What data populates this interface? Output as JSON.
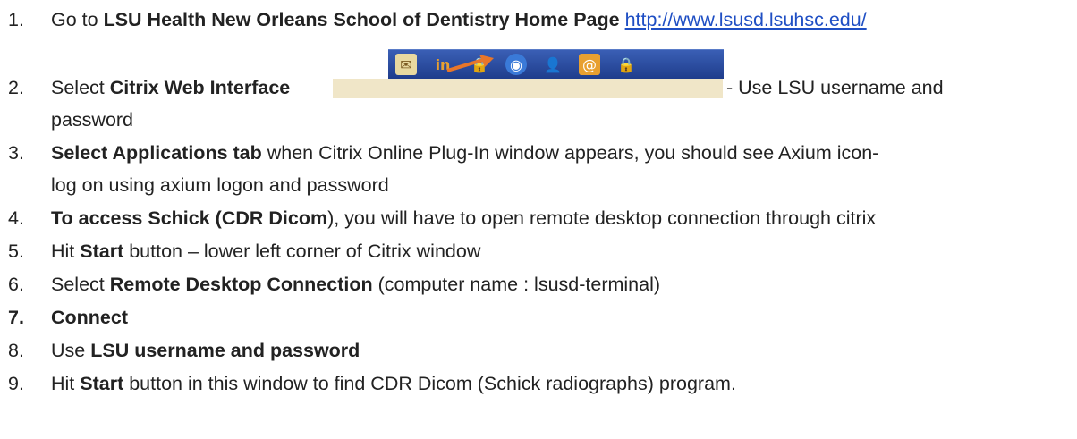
{
  "steps": [
    {
      "number": "1.",
      "pre": "Go to ",
      "bold": "LSU Health New Orleans School of Dentistry Home Page",
      "link": "http://www.lsusd.lsuhsc.edu/"
    },
    {
      "number": "2.",
      "pre": "Select ",
      "bold": "Citrix Web Interface",
      "post": "- Use LSU username and",
      "line2": "password"
    },
    {
      "number": "3.",
      "bold": "Select Applications tab",
      "post": " when Citrix Online Plug-In window appears, you should see Axium icon-",
      "line2": "log on using axium logon and password"
    },
    {
      "number": "4.",
      "bold": "To access Schick (CDR Dicom",
      "post": "), you will have to open remote desktop connection through citrix"
    },
    {
      "number": "5.",
      "pre": "Hit ",
      "bold": "Start",
      "post": " button – lower left corner of Citrix window"
    },
    {
      "number": "6.",
      "pre": "Select ",
      "bold": "Remote Desktop Connection",
      "post": " (computer name : lsusd-terminal)"
    },
    {
      "number": "7.",
      "bold": "Connect"
    },
    {
      "number": "8.",
      "pre": "Use ",
      "bold": "LSU username and password"
    },
    {
      "number": "9.",
      "pre": "Hit ",
      "bold": "Start",
      "post": " button in this window to find CDR Dicom (Schick radiographs) program."
    }
  ],
  "toolbar": {
    "icons": [
      "mail-icon",
      "linkedin-icon",
      "lock-arrow-icon",
      "citrix-icon",
      "user-icon",
      "address-book-icon",
      "padlock-icon"
    ],
    "colors": {
      "bar": "#2a4a9e",
      "strip": "#f0e6c8",
      "arrow": "#e8762a"
    }
  }
}
